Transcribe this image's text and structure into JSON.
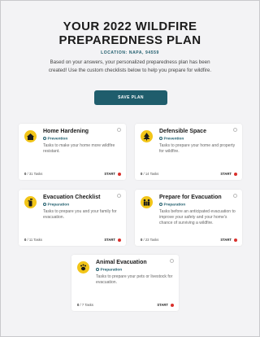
{
  "header": {
    "title_line1": "YOUR 2022 WILDFIRE",
    "title_line2": "PREPAREDNESS PLAN",
    "location": "LOCATION: NAPA, 94559",
    "intro": "Based on your answers, your personalized preparedness plan has been created! Use the custom checklists below to help you prepare for wildfire.",
    "save_label": "SAVE PLAN"
  },
  "cards": [
    {
      "title": "Home Hardening",
      "category": "Prevention",
      "desc": "Tasks to make your home more wildfire resistant.",
      "count_done": "0",
      "count_text": "/ 31 Tasks",
      "start": "START",
      "icon": "house-icon"
    },
    {
      "title": "Defensible Space",
      "category": "Prevention",
      "desc": "Tasks to prepare your home and property for wildfire.",
      "count_done": "0",
      "count_text": "/ 14 Tasks",
      "start": "START",
      "icon": "tree-icon"
    },
    {
      "title": "Evacuation Checklist",
      "category": "Preparation",
      "desc": "Tasks to prepare you and your family for evacuation.",
      "count_done": "0",
      "count_text": "/ 11 Tasks",
      "start": "START",
      "icon": "extinguisher-icon"
    },
    {
      "title": "Prepare for Evacuation",
      "category": "Preparation",
      "desc": "Tasks before an anticipated evacuation to improve your safety and your home's chance of surviving a wildfire.",
      "count_done": "0",
      "count_text": "/ 23 Tasks",
      "start": "START",
      "icon": "family-icon"
    },
    {
      "title": "Animal Evacuation",
      "category": "Preparation",
      "desc": "Tasks to prepare your pets or livestock for evacuation.",
      "count_done": "0",
      "count_text": "/ 7 Tasks",
      "start": "START",
      "icon": "paw-icon"
    }
  ],
  "colors": {
    "accent": "#1f5d6c",
    "icon_bg": "#f2c518",
    "start": "#d9302c"
  }
}
